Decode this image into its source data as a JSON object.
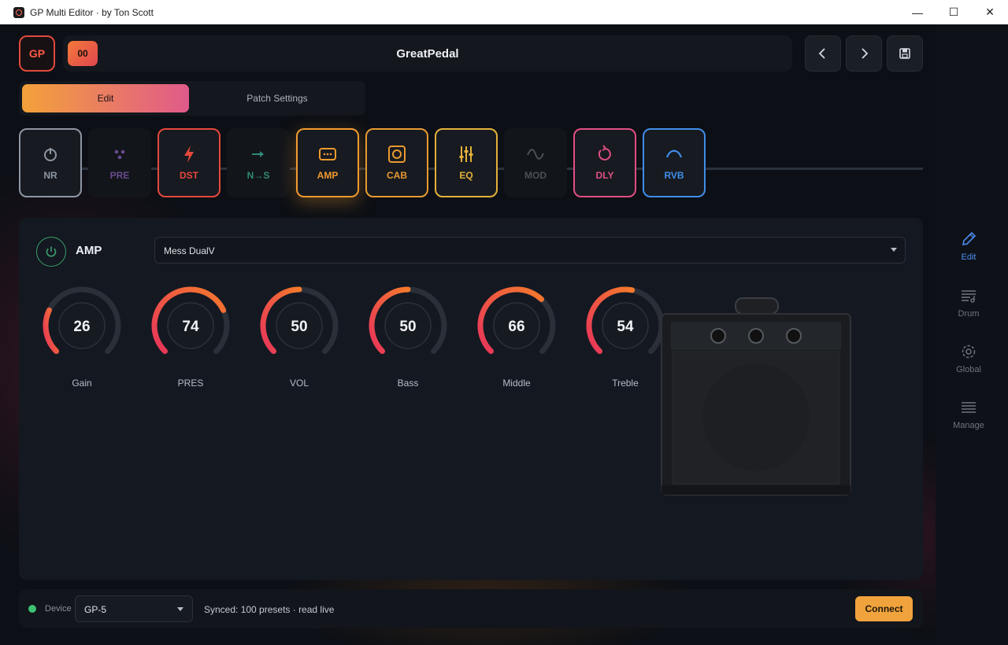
{
  "window": {
    "title": "GP Multi Editor  ·  by Ton Scott",
    "minimize": "—",
    "maximize": "☐",
    "close": "✕"
  },
  "header": {
    "logo": "GP",
    "preset_number": "00",
    "preset_name": "GreatPedal"
  },
  "tabs": {
    "edit": "Edit",
    "patch_settings": "Patch Settings"
  },
  "chain": [
    {
      "label": "NR",
      "icon": "nr-icon",
      "enabled": true,
      "color": "#8e96a3"
    },
    {
      "label": "PRE",
      "icon": "pre-icon",
      "enabled": false,
      "color": "#6a4b8e"
    },
    {
      "label": "DST",
      "icon": "bolt-icon",
      "enabled": true,
      "color": "#e5483d"
    },
    {
      "label": "N→S",
      "icon": "arrow-icon",
      "enabled": false,
      "color": "#2f8a78"
    },
    {
      "label": "AMP",
      "icon": "amp-icon",
      "enabled": true,
      "color": "#f29a2e"
    },
    {
      "label": "CAB",
      "icon": "speaker-icon",
      "enabled": true,
      "color": "#e99a32"
    },
    {
      "label": "EQ",
      "icon": "sliders-icon",
      "enabled": true,
      "color": "#e4b13b"
    },
    {
      "label": "MOD",
      "icon": "wave-icon",
      "enabled": false,
      "color": "#4b5059"
    },
    {
      "label": "DLY",
      "icon": "loop-icon",
      "enabled": true,
      "color": "#e04e86"
    },
    {
      "label": "RVB",
      "icon": "arc-icon",
      "enabled": true,
      "color": "#3f8ee8"
    }
  ],
  "panel": {
    "title": "AMP",
    "model": "Mess DualV",
    "knobs": [
      {
        "name": "Gain",
        "value": "26",
        "level": 0.26
      },
      {
        "name": "PRES",
        "value": "74",
        "level": 0.74
      },
      {
        "name": "VOL",
        "value": "50",
        "level": 0.5
      },
      {
        "name": "Bass",
        "value": "50",
        "level": 0.5
      },
      {
        "name": "Middle",
        "value": "66",
        "level": 0.66
      },
      {
        "name": "Treble",
        "value": "54",
        "level": 0.54
      }
    ]
  },
  "footer": {
    "device_label": "Device",
    "device": "GP-5",
    "status": "Synced: 100 presets · read live",
    "connect": "Connect"
  },
  "rail": [
    {
      "label": "Edit",
      "icon": "pencil-icon",
      "active": true
    },
    {
      "label": "Drum",
      "icon": "drum-icon",
      "active": false
    },
    {
      "label": "Global",
      "icon": "gear-icon",
      "active": false
    },
    {
      "label": "Manage",
      "icon": "list-icon",
      "active": false
    }
  ],
  "colors": {
    "accent": "#f0a33c",
    "active_rail": "#4b8cf0",
    "power": "#3aa06a"
  }
}
